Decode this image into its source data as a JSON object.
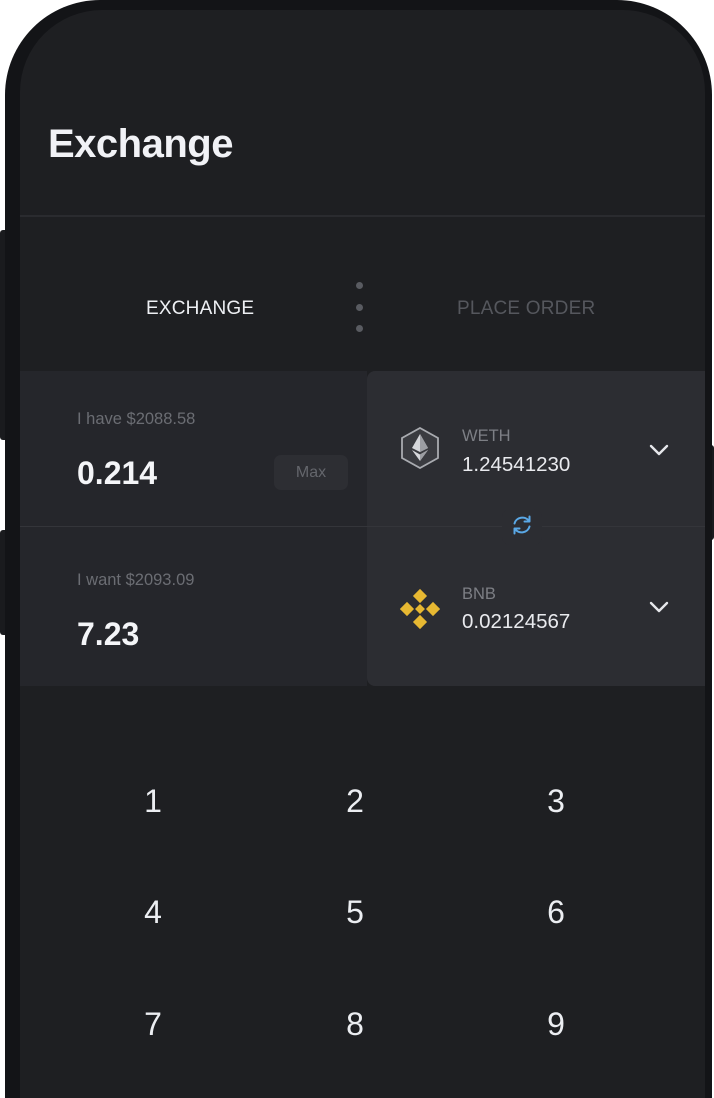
{
  "header": {
    "title": "Exchange"
  },
  "tabs": [
    {
      "label": "EXCHANGE",
      "active": true
    },
    {
      "label": "PLACE ORDER",
      "active": false
    }
  ],
  "from": {
    "hint": "I have $2088.58",
    "amount": "0.214",
    "max_label": "Max",
    "token": {
      "symbol": "WETH",
      "balance": "1.24541230",
      "icon": "ethereum-icon"
    }
  },
  "to": {
    "hint": "I want $2093.09",
    "amount": "7.23",
    "token": {
      "symbol": "BNB",
      "balance": "0.02124567",
      "icon": "binance-icon"
    }
  },
  "keypad": {
    "keys": [
      "1",
      "2",
      "3",
      "4",
      "5",
      "6",
      "7",
      "8",
      "9"
    ]
  },
  "colors": {
    "background": "#1e1f22",
    "accent_swap": "#5aa8e6",
    "bnb_gold": "#e7b832",
    "text_primary": "#f1f2f6",
    "text_muted": "#6b6d73"
  }
}
